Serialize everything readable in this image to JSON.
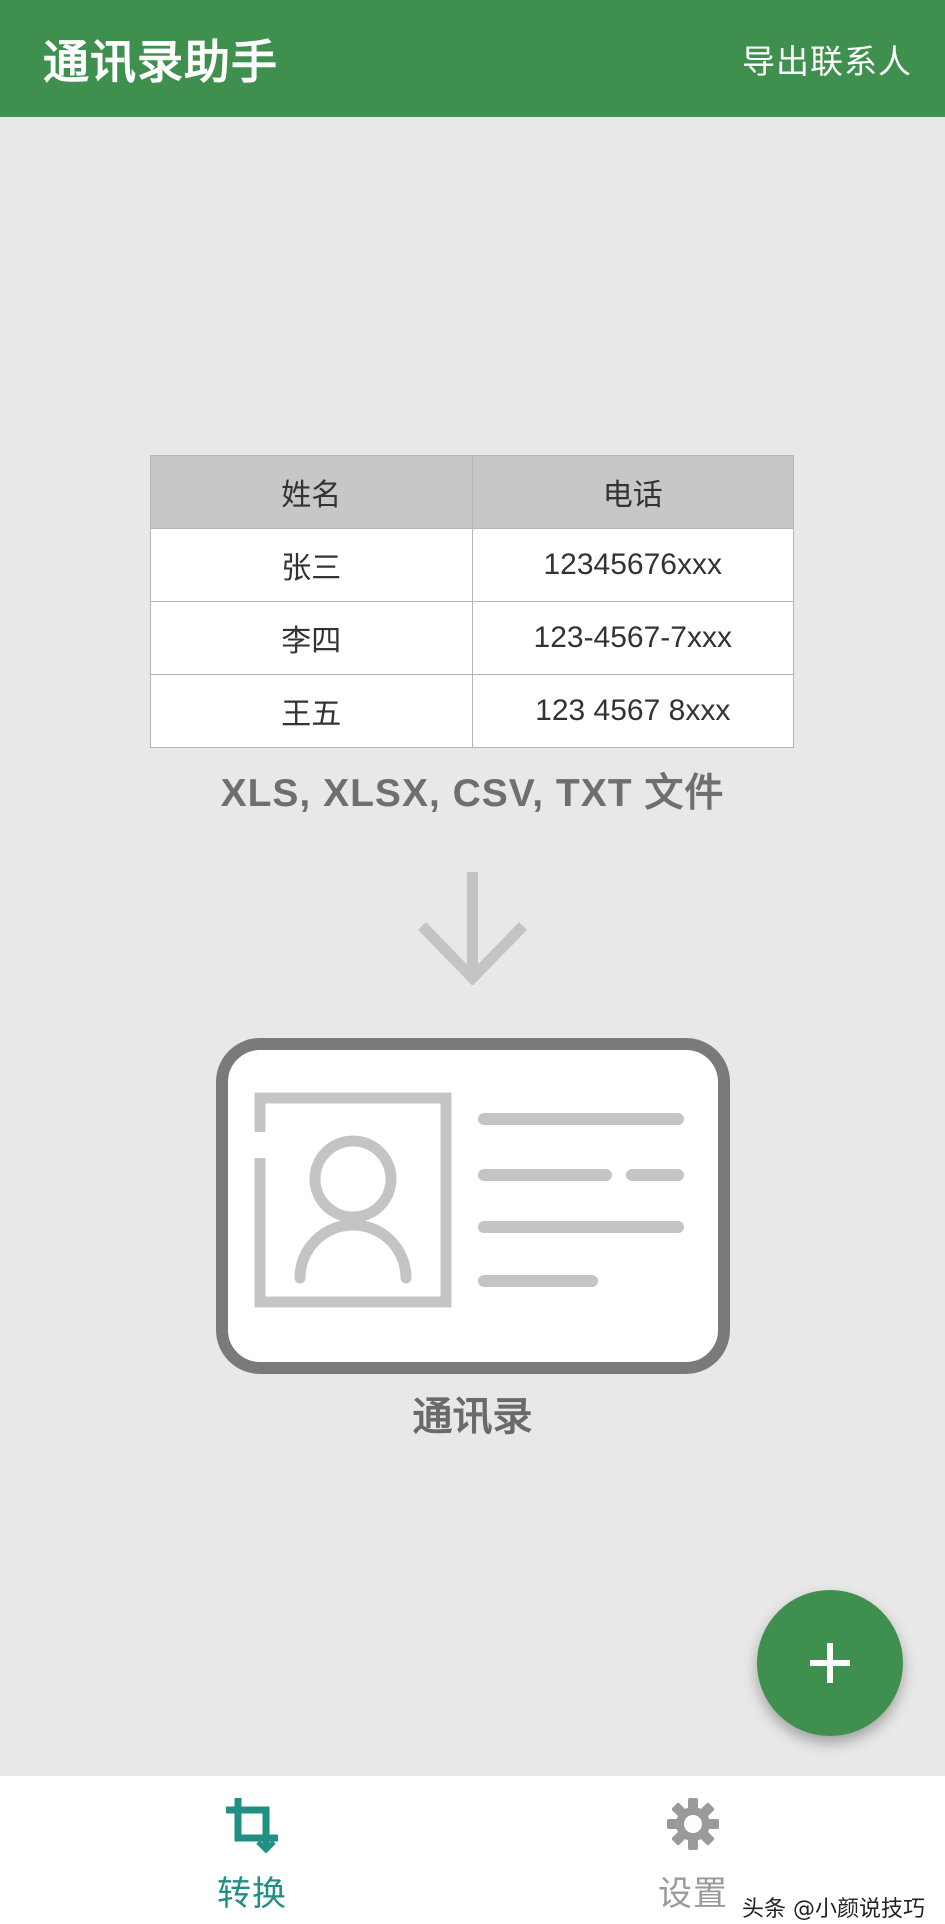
{
  "app_bar": {
    "title": "通讯录助手",
    "action_label": "导出联系人",
    "background": "#3f8f4e"
  },
  "sample_table": {
    "headers": [
      "姓名",
      "电话"
    ],
    "rows": [
      [
        "张三",
        "12345676xxx"
      ],
      [
        "李四",
        "123-4567-7xxx"
      ],
      [
        "王五",
        "123 4567 8xxx"
      ]
    ]
  },
  "formats_text": "XLS, XLSX, CSV, TXT 文件",
  "contacts_label": "通讯录",
  "fab": {
    "icon": "plus-icon",
    "color": "#3f8f4e"
  },
  "bottom_nav": {
    "items": [
      {
        "label": "转换",
        "icon": "crop-icon",
        "active": true,
        "color": "#1f9082"
      },
      {
        "label": "设置",
        "icon": "gear-icon",
        "active": false,
        "color": "#9a9a9a"
      }
    ]
  },
  "watermark": "头条 @小颜说技巧"
}
